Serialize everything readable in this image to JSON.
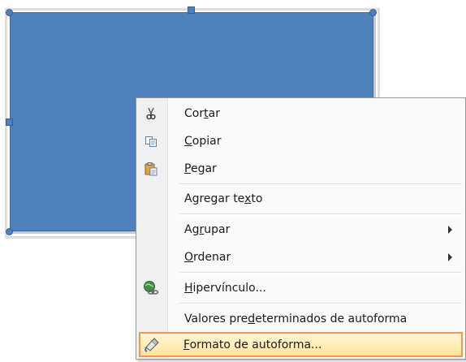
{
  "menu": {
    "items": [
      {
        "pre": "Cor",
        "u": "t",
        "post": "ar",
        "icon": "scissors-icon"
      },
      {
        "pre": "",
        "u": "C",
        "post": "opiar",
        "icon": "copy-icon"
      },
      {
        "pre": "",
        "u": "P",
        "post": "egar",
        "icon": "paste-icon"
      },
      {
        "pre": "Agregar te",
        "u": "x",
        "post": "to",
        "icon": ""
      },
      {
        "pre": "Ag",
        "u": "r",
        "post": "upar",
        "icon": "",
        "submenu": true
      },
      {
        "pre": "",
        "u": "O",
        "post": "rdenar",
        "icon": "",
        "submenu": true
      },
      {
        "pre": "",
        "u": "H",
        "post": "ipervínculo...",
        "icon": "hyperlink-icon"
      },
      {
        "pre": "Valores pre",
        "u": "d",
        "post": "eterminados de autoforma",
        "icon": ""
      },
      {
        "pre": "",
        "u": "F",
        "post": "ormato de autoforma...",
        "icon": "format-shape-icon",
        "highlighted": true
      }
    ]
  },
  "colors": {
    "shape_fill": "#4f81bd",
    "highlight_border": "#f79646",
    "highlight_fill": "#ffe59a"
  }
}
